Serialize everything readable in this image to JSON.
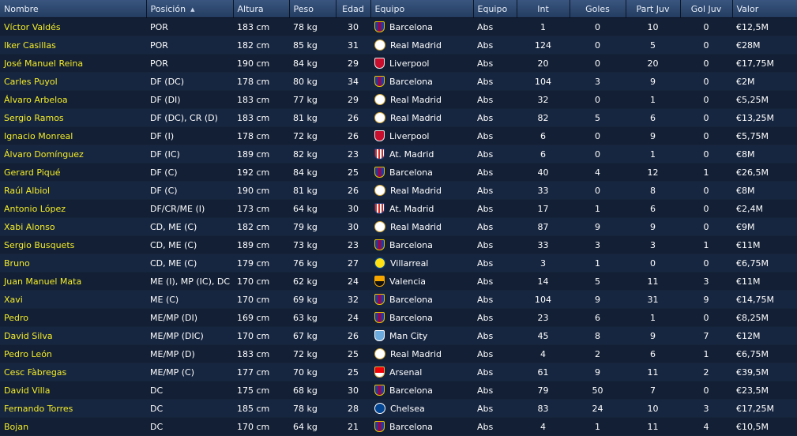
{
  "columns": [
    "Nombre",
    "Posición",
    "Altura",
    "Peso",
    "Edad",
    "Equipo",
    "Equipo",
    "Int",
    "Goles",
    "Part Juv",
    "Gol Juv",
    "Valor"
  ],
  "players": [
    {
      "name": "Víctor Valdés",
      "pos": "POR",
      "height": "183 cm",
      "weight": "78 kg",
      "age": "30",
      "club": "Barcelona",
      "clubIcon": "barcelona",
      "team": "Abs",
      "caps": "1",
      "goals": "0",
      "u21caps": "10",
      "u21goals": "0",
      "value": "€12,5M"
    },
    {
      "name": "Iker Casillas",
      "pos": "POR",
      "height": "182 cm",
      "weight": "85 kg",
      "age": "31",
      "club": "Real Madrid",
      "clubIcon": "real",
      "team": "Abs",
      "caps": "124",
      "goals": "0",
      "u21caps": "5",
      "u21goals": "0",
      "value": "€28M"
    },
    {
      "name": "José Manuel Reina",
      "pos": "POR",
      "height": "190 cm",
      "weight": "84 kg",
      "age": "29",
      "club": "Liverpool",
      "clubIcon": "liverpool",
      "team": "Abs",
      "caps": "20",
      "goals": "0",
      "u21caps": "20",
      "u21goals": "0",
      "value": "€17,75M"
    },
    {
      "name": "Carles Puyol",
      "pos": "DF (DC)",
      "height": "178 cm",
      "weight": "80 kg",
      "age": "34",
      "club": "Barcelona",
      "clubIcon": "barcelona",
      "team": "Abs",
      "caps": "104",
      "goals": "3",
      "u21caps": "9",
      "u21goals": "0",
      "value": "€2M"
    },
    {
      "name": "Álvaro Arbeloa",
      "pos": "DF (DI)",
      "height": "183 cm",
      "weight": "77 kg",
      "age": "29",
      "club": "Real Madrid",
      "clubIcon": "real",
      "team": "Abs",
      "caps": "32",
      "goals": "0",
      "u21caps": "1",
      "u21goals": "0",
      "value": "€5,25M"
    },
    {
      "name": "Sergio Ramos",
      "pos": "DF (DC), CR (D)",
      "height": "183 cm",
      "weight": "81 kg",
      "age": "26",
      "club": "Real Madrid",
      "clubIcon": "real",
      "team": "Abs",
      "caps": "82",
      "goals": "5",
      "u21caps": "6",
      "u21goals": "0",
      "value": "€13,25M"
    },
    {
      "name": "Ignacio Monreal",
      "pos": "DF (I)",
      "height": "178 cm",
      "weight": "72 kg",
      "age": "26",
      "club": "Liverpool",
      "clubIcon": "liverpool",
      "team": "Abs",
      "caps": "6",
      "goals": "0",
      "u21caps": "9",
      "u21goals": "0",
      "value": "€5,75M"
    },
    {
      "name": "Álvaro Domínguez",
      "pos": "DF (IC)",
      "height": "189 cm",
      "weight": "82 kg",
      "age": "23",
      "club": "At. Madrid",
      "clubIcon": "atletico",
      "team": "Abs",
      "caps": "6",
      "goals": "0",
      "u21caps": "1",
      "u21goals": "0",
      "value": "€8M"
    },
    {
      "name": "Gerard Piqué",
      "pos": "DF (C)",
      "height": "192 cm",
      "weight": "84 kg",
      "age": "25",
      "club": "Barcelona",
      "clubIcon": "barcelona",
      "team": "Abs",
      "caps": "40",
      "goals": "4",
      "u21caps": "12",
      "u21goals": "1",
      "value": "€26,5M"
    },
    {
      "name": "Raúl Albiol",
      "pos": "DF (C)",
      "height": "190 cm",
      "weight": "81 kg",
      "age": "26",
      "club": "Real Madrid",
      "clubIcon": "real",
      "team": "Abs",
      "caps": "33",
      "goals": "0",
      "u21caps": "8",
      "u21goals": "0",
      "value": "€8M"
    },
    {
      "name": "Antonio López",
      "pos": "DF/CR/ME (I)",
      "height": "173 cm",
      "weight": "64 kg",
      "age": "30",
      "club": "At. Madrid",
      "clubIcon": "atletico",
      "team": "Abs",
      "caps": "17",
      "goals": "1",
      "u21caps": "6",
      "u21goals": "0",
      "value": "€2,4M"
    },
    {
      "name": "Xabi Alonso",
      "pos": "CD, ME (C)",
      "height": "182 cm",
      "weight": "79 kg",
      "age": "30",
      "club": "Real Madrid",
      "clubIcon": "real",
      "team": "Abs",
      "caps": "87",
      "goals": "9",
      "u21caps": "9",
      "u21goals": "0",
      "value": "€9M"
    },
    {
      "name": "Sergio Busquets",
      "pos": "CD, ME (C)",
      "height": "189 cm",
      "weight": "73 kg",
      "age": "23",
      "club": "Barcelona",
      "clubIcon": "barcelona",
      "team": "Abs",
      "caps": "33",
      "goals": "3",
      "u21caps": "3",
      "u21goals": "1",
      "value": "€11M"
    },
    {
      "name": "Bruno",
      "pos": "CD, ME (C)",
      "height": "179 cm",
      "weight": "76 kg",
      "age": "27",
      "club": "Villarreal",
      "clubIcon": "villarreal",
      "team": "Abs",
      "caps": "3",
      "goals": "1",
      "u21caps": "0",
      "u21goals": "0",
      "value": "€6,75M"
    },
    {
      "name": "Juan Manuel Mata",
      "pos": "ME (I), MP (IC), DC",
      "height": "170 cm",
      "weight": "62 kg",
      "age": "24",
      "club": "Valencia",
      "clubIcon": "valencia",
      "team": "Abs",
      "caps": "14",
      "goals": "5",
      "u21caps": "11",
      "u21goals": "3",
      "value": "€11M"
    },
    {
      "name": "Xavi",
      "pos": "ME (C)",
      "height": "170 cm",
      "weight": "69 kg",
      "age": "32",
      "club": "Barcelona",
      "clubIcon": "barcelona",
      "team": "Abs",
      "caps": "104",
      "goals": "9",
      "u21caps": "31",
      "u21goals": "9",
      "value": "€14,75M"
    },
    {
      "name": "Pedro",
      "pos": "ME/MP (DI)",
      "height": "169 cm",
      "weight": "63 kg",
      "age": "24",
      "club": "Barcelona",
      "clubIcon": "barcelona",
      "team": "Abs",
      "caps": "23",
      "goals": "6",
      "u21caps": "1",
      "u21goals": "0",
      "value": "€8,25M"
    },
    {
      "name": "David Silva",
      "pos": "ME/MP (DIC)",
      "height": "170 cm",
      "weight": "67 kg",
      "age": "26",
      "club": "Man City",
      "clubIcon": "mancity",
      "team": "Abs",
      "caps": "45",
      "goals": "8",
      "u21caps": "9",
      "u21goals": "7",
      "value": "€12M"
    },
    {
      "name": "Pedro León",
      "pos": "ME/MP (D)",
      "height": "183 cm",
      "weight": "72 kg",
      "age": "25",
      "club": "Real Madrid",
      "clubIcon": "real",
      "team": "Abs",
      "caps": "4",
      "goals": "2",
      "u21caps": "6",
      "u21goals": "1",
      "value": "€6,75M"
    },
    {
      "name": "Cesc Fàbregas",
      "pos": "ME/MP (C)",
      "height": "177 cm",
      "weight": "70 kg",
      "age": "25",
      "club": "Arsenal",
      "clubIcon": "arsenal",
      "team": "Abs",
      "caps": "61",
      "goals": "9",
      "u21caps": "11",
      "u21goals": "2",
      "value": "€39,5M"
    },
    {
      "name": "David Villa",
      "pos": "DC",
      "height": "175 cm",
      "weight": "68 kg",
      "age": "30",
      "club": "Barcelona",
      "clubIcon": "barcelona",
      "team": "Abs",
      "caps": "79",
      "goals": "50",
      "u21caps": "7",
      "u21goals": "0",
      "value": "€23,5M"
    },
    {
      "name": "Fernando Torres",
      "pos": "DC",
      "height": "185 cm",
      "weight": "78 kg",
      "age": "28",
      "club": "Chelsea",
      "clubIcon": "chelsea",
      "team": "Abs",
      "caps": "83",
      "goals": "24",
      "u21caps": "10",
      "u21goals": "3",
      "value": "€17,25M"
    },
    {
      "name": "Bojan",
      "pos": "DC",
      "height": "170 cm",
      "weight": "64 kg",
      "age": "21",
      "club": "Barcelona",
      "clubIcon": "barcelona",
      "team": "Abs",
      "caps": "4",
      "goals": "1",
      "u21caps": "11",
      "u21goals": "4",
      "value": "€10,5M"
    }
  ]
}
